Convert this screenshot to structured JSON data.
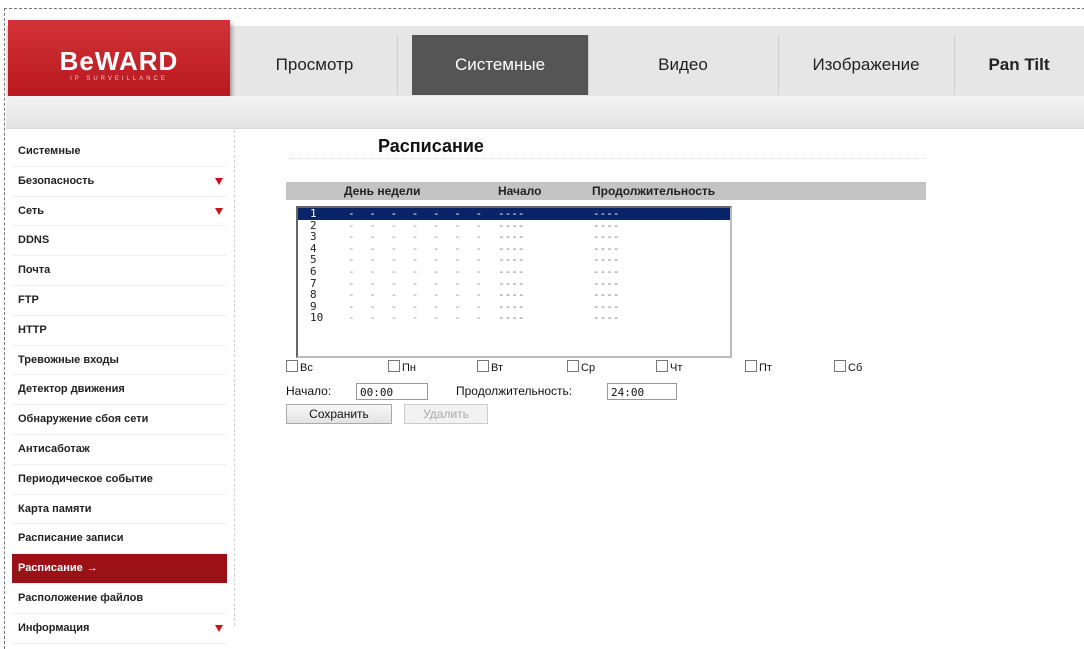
{
  "logo": {
    "text": "BeWARD",
    "subtext": "IP SURVEILLANCE"
  },
  "tabs": [
    {
      "label": "Просмотр"
    },
    {
      "label": "Системные"
    },
    {
      "label": "Видео"
    },
    {
      "label": "Изображение"
    },
    {
      "label": "Pan Tilt"
    }
  ],
  "active_tab": "Системные",
  "sidebar": {
    "items": [
      {
        "label": "Системные"
      },
      {
        "label": "Безопасность"
      },
      {
        "label": "Сеть"
      },
      {
        "label": "DDNS"
      },
      {
        "label": "Почта"
      },
      {
        "label": "FTP"
      },
      {
        "label": "HTTP"
      },
      {
        "label": "Тревожные входы"
      },
      {
        "label": "Детектор движения"
      },
      {
        "label": "Обнаружение сбоя сети"
      },
      {
        "label": "Антисаботаж"
      },
      {
        "label": "Периодическое событие"
      },
      {
        "label": "Карта памяти"
      },
      {
        "label": "Расписание записи"
      },
      {
        "label": "Расписание",
        "arrow": "→"
      },
      {
        "label": "Расположение файлов"
      },
      {
        "label": "Информация"
      }
    ],
    "active_item": "Расписание",
    "expandable": [
      "Безопасность",
      "Сеть",
      "Информация"
    ],
    "active_color": "#9b1116"
  },
  "main": {
    "title": "Расписание",
    "table_headers": {
      "day": "День недели",
      "start": "Начало",
      "duration": "Продолжительность"
    },
    "rows": [
      {
        "num": "1",
        "days": "- - - - - - -",
        "start": "----",
        "duration": "----"
      },
      {
        "num": "2",
        "days": "- - - - - - -",
        "start": "----",
        "duration": "----"
      },
      {
        "num": "3",
        "days": "- - - - - - -",
        "start": "----",
        "duration": "----"
      },
      {
        "num": "4",
        "days": "- - - - - - -",
        "start": "----",
        "duration": "----"
      },
      {
        "num": "5",
        "days": "- - - - - - -",
        "start": "----",
        "duration": "----"
      },
      {
        "num": "6",
        "days": "- - - - - - -",
        "start": "----",
        "duration": "----"
      },
      {
        "num": "7",
        "days": "- - - - - - -",
        "start": "----",
        "duration": "----"
      },
      {
        "num": "8",
        "days": "- - - - - - -",
        "start": "----",
        "duration": "----"
      },
      {
        "num": "9",
        "days": "- - - - - - -",
        "start": "----",
        "duration": "----"
      },
      {
        "num": "10",
        "days": "- - - - - - -",
        "start": "----",
        "duration": "----"
      }
    ],
    "selected_row": "1",
    "weekdays": [
      "Вс",
      "Пн",
      "Вт",
      "Ср",
      "Чт",
      "Пт",
      "Сб"
    ],
    "start_label": "Начало:",
    "start_value": "00:00",
    "duration_label": "Продолжительность:",
    "duration_value": "24:00",
    "save_label": "Сохранить",
    "delete_label": "Удалить"
  },
  "colors": {
    "brand_red": "#c4151c",
    "tab_active_bg": "#555555",
    "selection": "#0a246a"
  }
}
